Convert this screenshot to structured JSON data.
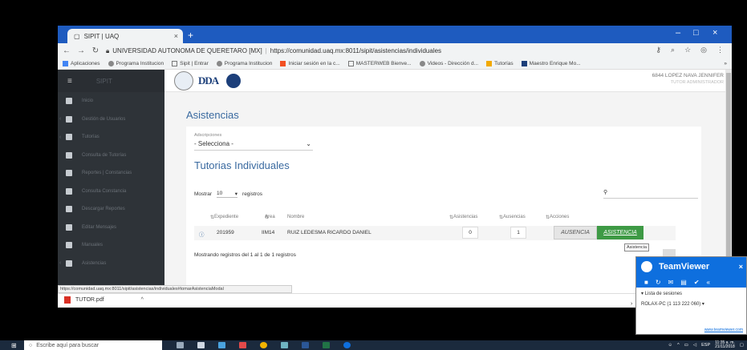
{
  "browser": {
    "tab_title": "SIPIT | UAQ",
    "tab_close": "×",
    "new_tab": "+",
    "win_min": "–",
    "win_max": "□",
    "win_close": "×",
    "url_origin": "UNIVERSIDAD AUTONOMA DE QUERETARO [MX]",
    "url": "https://comunidad.uaq.mx:8011/sipit/asistencias/individuales",
    "bookmarks": [
      "Aplicaciones",
      "Programa Institucion",
      "Sipit | Entrar",
      "Programa Institucion",
      "Iniciar sesión en la c...",
      "MASTERWEB Bienve...",
      "Videos - Dirección d...",
      "Tutorías",
      "Maestro Enrique Mo..."
    ],
    "bookmarks_more": "»"
  },
  "sidebar": {
    "brand": "SIPIT",
    "items": [
      "Inicio",
      "Gestión de Usuarios",
      "Tutorías",
      "Consulta de Tutorías",
      "Reportes | Constancias",
      "Consulta Constancia",
      "Descargar Reportes",
      "Editar Mensajes",
      "Manuales",
      "Asistencias"
    ]
  },
  "header": {
    "logo_text": "DDA",
    "user_name": "6844 LOPEZ NAVA JENNIFER",
    "user_role": "TUTOR ADMINISTRADOR"
  },
  "main": {
    "title": "Asistencias",
    "adscripciones_label": "Adscripciones",
    "adscripciones_value": "- Selecciona -",
    "section_title": "Tutorias Individuales",
    "show_label": "Mostrar",
    "show_value": "10",
    "records_label": "registros",
    "columns": [
      "Expediente",
      "Area",
      "Nombre",
      "Asistencias",
      "Ausencias",
      "Acciones"
    ],
    "rows": [
      {
        "expediente": "201959",
        "area": "IIM14",
        "nombre": "RUIZ LEDESMA RICARDO DANIEL",
        "asistencias": "0",
        "ausencias": "1",
        "btn_ausencia": "AUSENCIA",
        "btn_asistencia": "ASISTENCIA"
      }
    ],
    "showing": "Mostrando registros del 1 al 1 de 1 registros",
    "tooltip": "Asistencia"
  },
  "statusbar": {
    "url": "https://comunidad.uaq.mx:8011/sipit/asistencias/individuales#tomarAsistenciaModal"
  },
  "downloads": {
    "file": "TUTOR.pdf",
    "chevron": "^"
  },
  "teamviewer": {
    "title": "TeamViewer",
    "close": "×",
    "list_label": "▾ Lista de sesiones",
    "session": "ROLAX-PC (1 113 222 060) ▾",
    "link": "www.teamviewer.com"
  },
  "taskbar": {
    "search_placeholder": "Escribe aquí para buscar",
    "lang": "ESP",
    "time": "11:35 a. m.",
    "date": "21/11/2018"
  },
  "colors": {
    "chrome_blue": "#1e5bbf",
    "sidebar": "#2e3338",
    "heading_blue": "#3a6aa0",
    "green_button": "#3e9a45",
    "teamviewer_blue": "#0e6fde",
    "taskbar": "#1b2a3d"
  }
}
